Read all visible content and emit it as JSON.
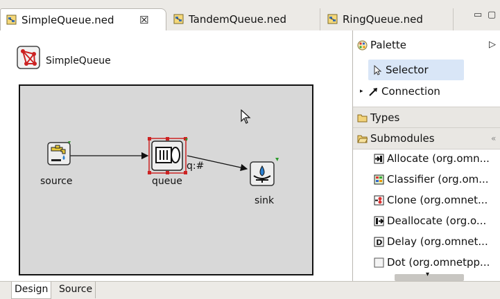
{
  "tabs": [
    {
      "label": "SimpleQueue.ned",
      "close": "☒",
      "active": true
    },
    {
      "label": "TandemQueue.ned",
      "active": false
    },
    {
      "label": "RingQueue.ned",
      "active": false
    }
  ],
  "window_controls": {
    "minimize": "▭",
    "maximize": "▢"
  },
  "network": {
    "name": "SimpleQueue",
    "modules": {
      "source": "source",
      "queue": "queue",
      "sink": "sink"
    },
    "gate_label": "q:#"
  },
  "palette": {
    "title": "Palette",
    "collapse_arrow": "▷",
    "tools": [
      {
        "label": "Selector",
        "selected": true
      },
      {
        "label": "Connection",
        "selected": false
      }
    ],
    "types_label": "Types",
    "submodules_label": "Submodules",
    "submodules_ctrl": "«",
    "submodules": [
      {
        "label": "Allocate (org.omn..."
      },
      {
        "label": "Classifier (org.om..."
      },
      {
        "label": "Clone (org.omnet..."
      },
      {
        "label": "Deallocate (org.o..."
      },
      {
        "label": "Delay (org.omnet..."
      },
      {
        "label": "Dot (org.omnetpp..."
      }
    ]
  },
  "bottom_tabs": [
    {
      "label": "Design",
      "active": true
    },
    {
      "label": "Source",
      "active": false
    }
  ],
  "colors": {
    "selection": "#d9e6f7",
    "accent": "#cc2222",
    "module_bg": "#eeeeee",
    "network_bg": "#d8d8d8"
  }
}
